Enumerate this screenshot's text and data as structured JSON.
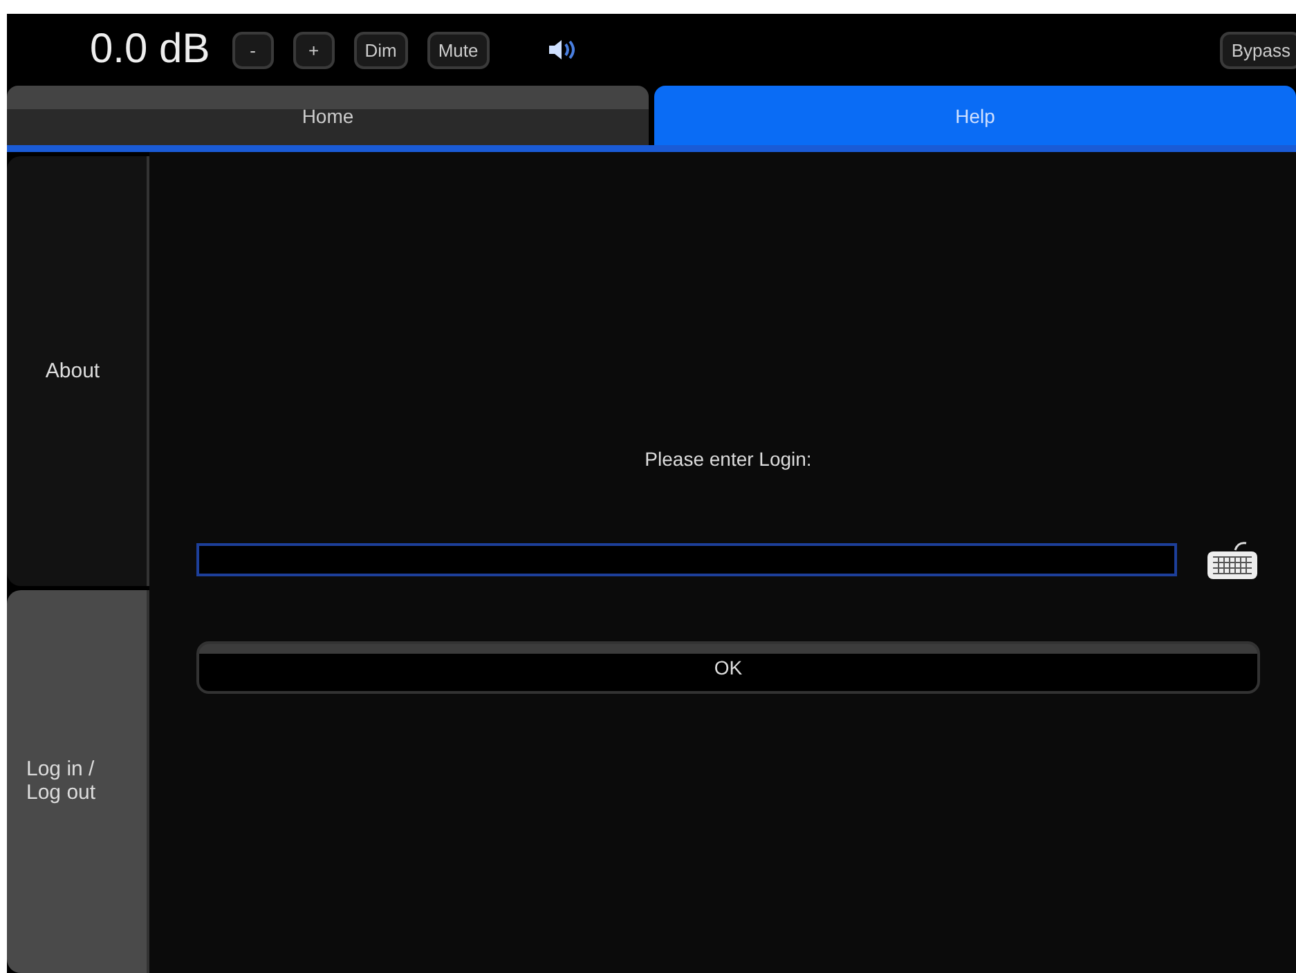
{
  "top_bar": {
    "volume": "0.0 dB",
    "buttons": [
      {
        "label": "-"
      },
      {
        "label": "+"
      },
      {
        "label": "Dim"
      },
      {
        "label": "Mute"
      }
    ],
    "bypass": "Bypass"
  },
  "tabs": [
    {
      "label": "Home",
      "selected": false
    },
    {
      "label": "Help",
      "selected": true
    }
  ],
  "sidebar": {
    "items": [
      {
        "label": "About",
        "selected": false
      },
      {
        "label": "Log in /\nLog out",
        "selected": true
      }
    ]
  },
  "login": {
    "prompt": "Please enter Login:",
    "button": "OK"
  }
}
